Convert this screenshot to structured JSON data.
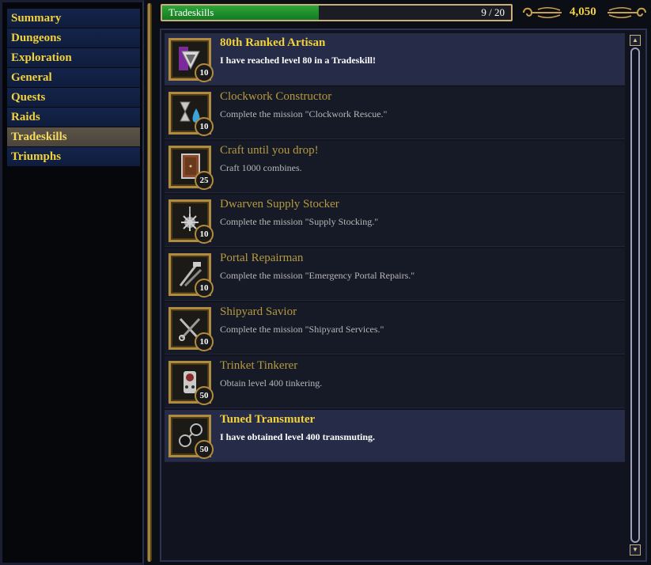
{
  "categories": [
    {
      "label": "Summary",
      "selected": false
    },
    {
      "label": "Dungeons",
      "selected": false
    },
    {
      "label": "Exploration",
      "selected": false
    },
    {
      "label": "General",
      "selected": false
    },
    {
      "label": "Quests",
      "selected": false
    },
    {
      "label": "Raids",
      "selected": false
    },
    {
      "label": "Tradeskills",
      "selected": true
    },
    {
      "label": "Triumphs",
      "selected": false
    }
  ],
  "header": {
    "category_label": "Tradeskills",
    "progress_text": "9 / 20",
    "progress_fraction": 0.45,
    "points": "4,050"
  },
  "achievements": [
    {
      "title": "80th Ranked Artisan",
      "description": "I have reached level 80 in a Tradeskill!",
      "points": "10",
      "completed": true,
      "icon": "artisan-rank-icon"
    },
    {
      "title": "Clockwork Constructor",
      "description": "Complete the mission \"Clockwork Rescue.\"",
      "points": "10",
      "completed": false,
      "icon": "hourglass-potion-icon"
    },
    {
      "title": "Craft until you drop!",
      "description": "Craft 1000 combines.",
      "points": "25",
      "completed": false,
      "icon": "cabinet-icon"
    },
    {
      "title": "Dwarven Supply Stocker",
      "description": "Complete the mission \"Supply Stocking.\"",
      "points": "10",
      "completed": false,
      "icon": "morningstar-icon"
    },
    {
      "title": "Portal Repairman",
      "description": "Complete the mission \"Emergency Portal Repairs.\"",
      "points": "10",
      "completed": false,
      "icon": "repair-tools-icon"
    },
    {
      "title": "Shipyard Savior",
      "description": "Complete the mission \"Shipyard Services.\"",
      "points": "10",
      "completed": false,
      "icon": "crossed-tools-icon"
    },
    {
      "title": "Trinket Tinkerer",
      "description": "Obtain level 400 tinkering.",
      "points": "50",
      "completed": false,
      "icon": "clockwork-trinket-icon"
    },
    {
      "title": "Tuned Transmuter",
      "description": "I have obtained level 400 transmuting.",
      "points": "50",
      "completed": true,
      "icon": "spectacles-icon"
    }
  ],
  "colors": {
    "gold_text": "#f2d23a",
    "muted_title": "#b59a3e",
    "progress_green": "#2ea53a",
    "frame_gold": "#b08a3e",
    "selected_row": "#262c48"
  }
}
